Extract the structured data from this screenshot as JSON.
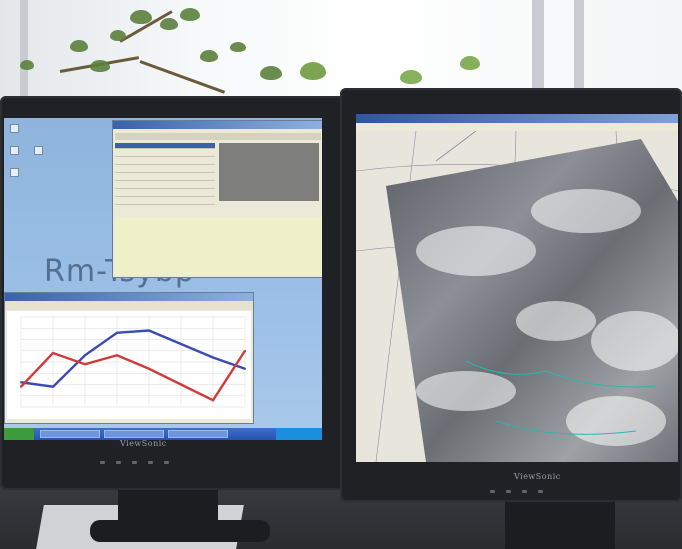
{
  "scene": {
    "monitor_left_brand": "ViewSonic",
    "monitor_right_brand": "ViewSonic",
    "desktop_watermark": "Rm-Tsybp"
  },
  "chart_data": {
    "type": "line",
    "title": "",
    "xlabel": "",
    "ylabel": "",
    "x": [
      1,
      2,
      3,
      4,
      5,
      6,
      7,
      8
    ],
    "series": [
      {
        "values": [
          2.2,
          1.8,
          4.6,
          6.6,
          6.8,
          5.6,
          4.4,
          3.4
        ],
        "color": "#3a4bb5"
      },
      {
        "values": [
          1.8,
          4.8,
          3.8,
          4.6,
          3.4,
          2.0,
          0.6,
          5.0
        ],
        "color": "#d23a3a"
      }
    ],
    "ylim": [
      0,
      8
    ],
    "grid": true,
    "legend": "none"
  }
}
